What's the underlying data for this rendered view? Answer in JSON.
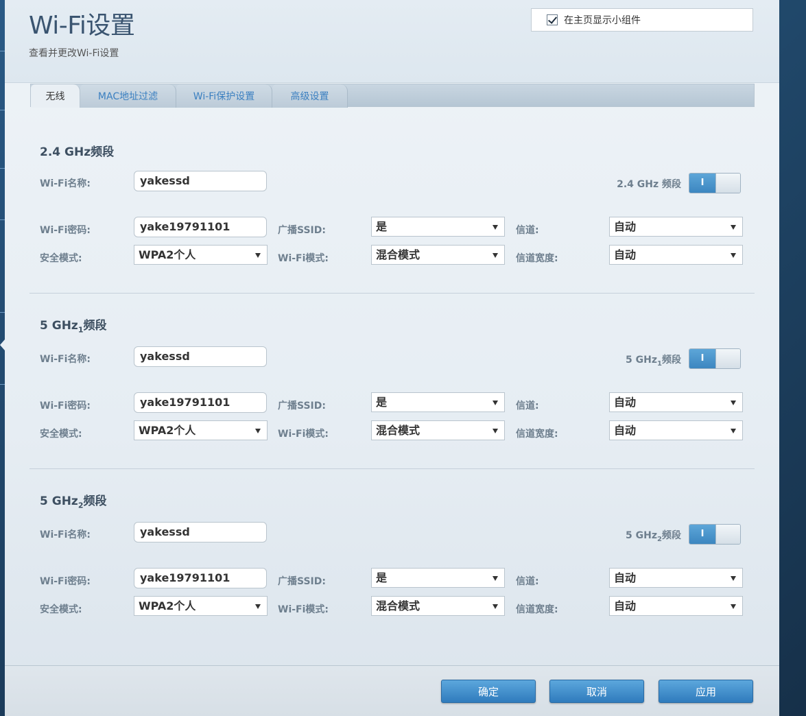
{
  "header": {
    "title": "Wi-Fi设置",
    "subtitle": "查看并更改Wi-Fi设置",
    "widget_label": "在主页显示小组件"
  },
  "tabs": [
    {
      "label": "无线",
      "active": true
    },
    {
      "label": "MAC地址过滤",
      "active": false
    },
    {
      "label": "Wi-Fi保护设置",
      "active": false
    },
    {
      "label": "高级设置",
      "active": false
    }
  ],
  "labels": {
    "wifi_name": "Wi-Fi名称:",
    "wifi_password": "Wi-Fi密码:",
    "security_mode": "安全模式:",
    "broadcast_ssid": "广播SSID:",
    "wifi_mode": "Wi-Fi模式:",
    "channel": "信道:",
    "channel_width": "信道宽度:",
    "band_suffix": "频段"
  },
  "bands": [
    {
      "base": "2.4 GHz",
      "sub": "",
      "wifi_name": "yakessd",
      "wifi_password": "yake19791101",
      "security_mode": "WPA2个人",
      "broadcast_ssid": "是",
      "wifi_mode": "混合模式",
      "channel": "自动",
      "channel_width": "自动",
      "switch_label": "I"
    },
    {
      "base": "5 GHz",
      "sub": "1",
      "wifi_name": "yakessd",
      "wifi_password": "yake19791101",
      "security_mode": "WPA2个人",
      "broadcast_ssid": "是",
      "wifi_mode": "混合模式",
      "channel": "自动",
      "channel_width": "自动",
      "switch_label": "I"
    },
    {
      "base": "5 GHz",
      "sub": "2",
      "wifi_name": "yakessd",
      "wifi_password": "yake19791101",
      "security_mode": "WPA2个人",
      "broadcast_ssid": "是",
      "wifi_mode": "混合模式",
      "channel": "自动",
      "channel_width": "自动",
      "switch_label": "I"
    }
  ],
  "footer": {
    "ok": "确定",
    "cancel": "取消",
    "apply": "应用"
  },
  "colors": {
    "accent": "#3c86c0",
    "title": "#3a5470",
    "link": "#3a7fc0"
  }
}
